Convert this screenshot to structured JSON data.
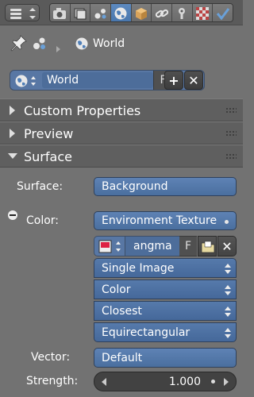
{
  "breadcrumb": {
    "label": "World"
  },
  "datablock": {
    "name": "World",
    "fake_user": "F"
  },
  "panels": [
    {
      "title": "Custom Properties",
      "expanded": false
    },
    {
      "title": "Preview",
      "expanded": false
    },
    {
      "title": "Surface",
      "expanded": true
    }
  ],
  "surface": {
    "surface_label": "Surface:",
    "surface_value": "Background",
    "color_label": "Color:",
    "color_value": "Environment Texture",
    "image_name": "angma",
    "image_fake_user": "F",
    "source": "Single Image",
    "color_space": "Color",
    "interpolation": "Closest",
    "projection": "Equirectangular",
    "vector_label": "Vector:",
    "vector_value": "Default",
    "strength_label": "Strength:",
    "strength_value": "1.000"
  },
  "colors": {
    "accent": "#4a6f9f",
    "bg": "#727272"
  }
}
